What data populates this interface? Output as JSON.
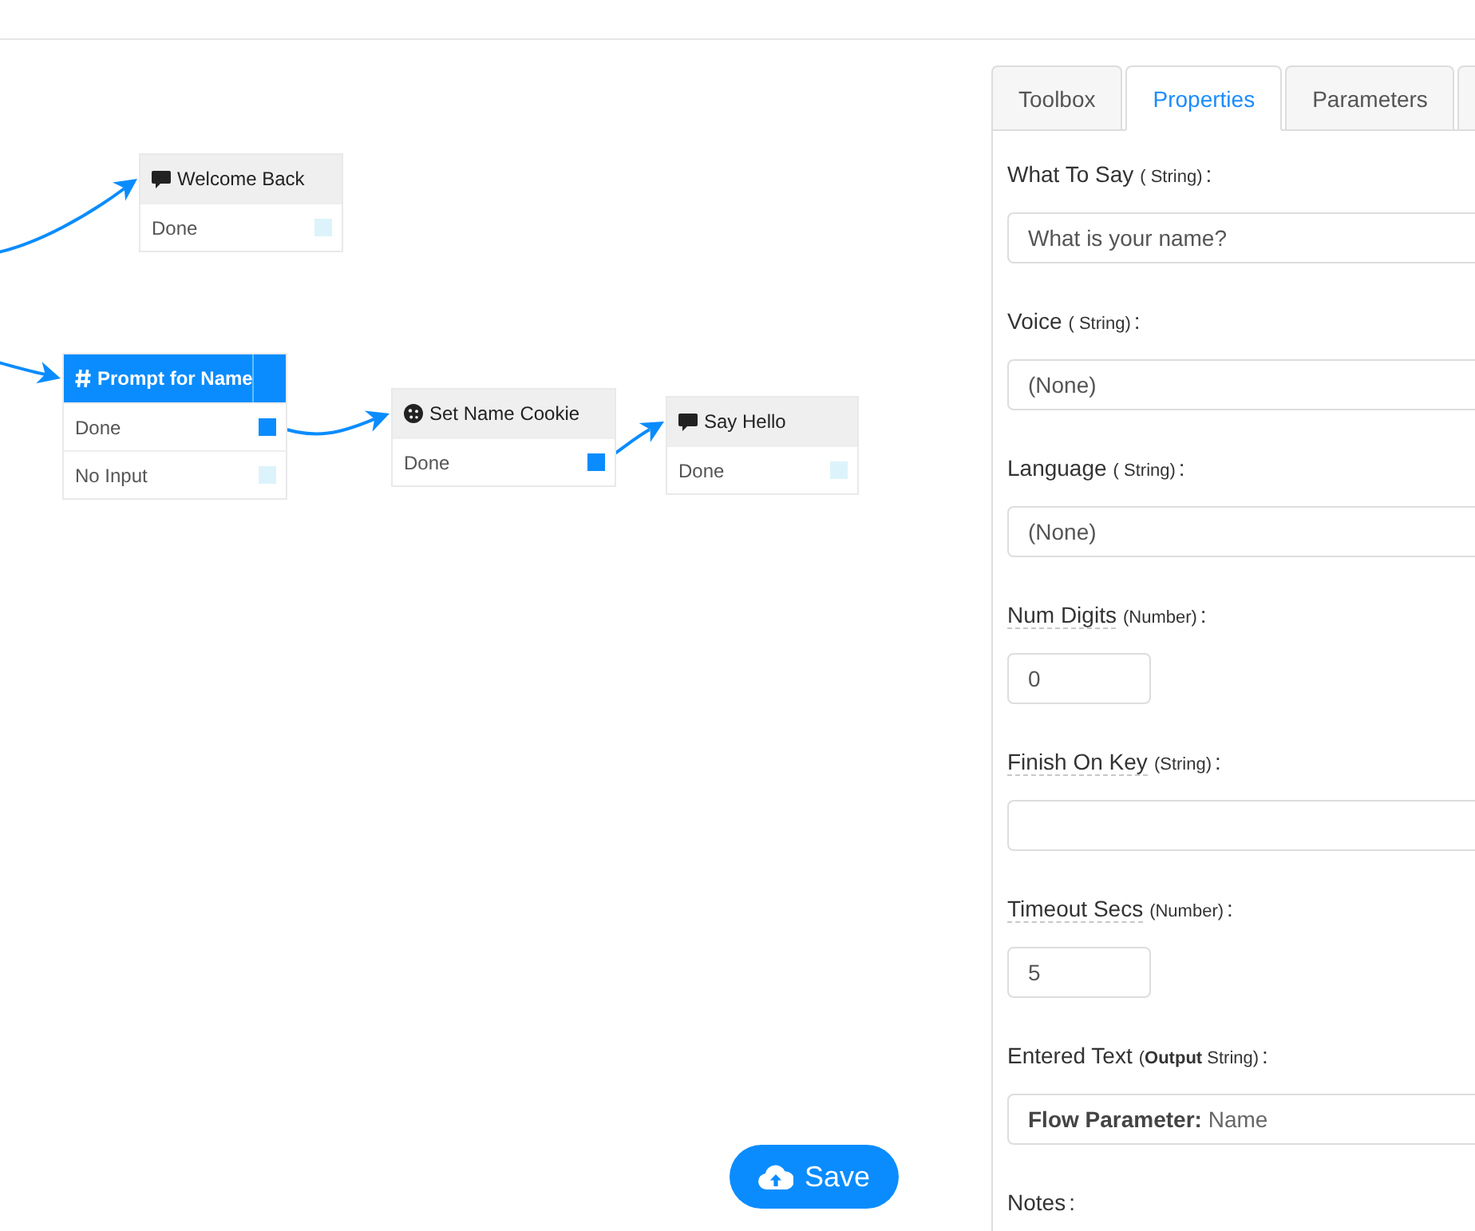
{
  "canvas": {
    "nodes": [
      {
        "kind": "say",
        "title": "Welcome Back",
        "selected": false,
        "outputs": [
          {
            "label": "Done",
            "connected": false
          }
        ]
      },
      {
        "kind": "prompt",
        "title": "Prompt for Name",
        "selected": true,
        "outputs": [
          {
            "label": "Done",
            "connected": true
          },
          {
            "label": "No Input",
            "connected": false
          }
        ]
      },
      {
        "kind": "cookie",
        "title": "Set Name Cookie",
        "selected": false,
        "outputs": [
          {
            "label": "Done",
            "connected": true
          }
        ]
      },
      {
        "kind": "say",
        "title": "Say Hello",
        "selected": false,
        "outputs": [
          {
            "label": "Done",
            "connected": false
          }
        ]
      }
    ]
  },
  "save_button": {
    "label": "Save"
  },
  "panel": {
    "tabs": [
      {
        "label": "Toolbox",
        "selected": false
      },
      {
        "label": "Properties",
        "selected": true
      },
      {
        "label": "Parameters",
        "selected": false
      },
      {
        "selected": false
      }
    ],
    "fields": [
      {
        "label": "What To Say",
        "type": "( String)",
        "suffix": ":",
        "help": false,
        "kind": "text",
        "value": "What is your name?"
      },
      {
        "label": "Voice",
        "type": "( String)",
        "suffix": ":",
        "help": false,
        "kind": "select",
        "value": "(None)"
      },
      {
        "label": "Language",
        "type": "( String)",
        "suffix": ":",
        "help": false,
        "kind": "select",
        "value": "(None)"
      },
      {
        "label": "Num Digits",
        "type": "(Number)",
        "suffix": ":",
        "help": true,
        "kind": "number",
        "value": "0"
      },
      {
        "label": "Finish On Key",
        "type": "(String)",
        "suffix": ":",
        "help": true,
        "kind": "text"
      },
      {
        "label": "Timeout Secs",
        "type": "(Number)",
        "suffix": ":",
        "help": true,
        "kind": "number",
        "value": "5"
      },
      {
        "label": "Entered Text",
        "type": "(**Output** String)",
        "suffix": ":",
        "help": false,
        "kind": "output",
        "value": "**Flow Parameter:** Name"
      },
      {
        "label": "Notes",
        "suffix": ":",
        "help": false
      }
    ]
  }
}
